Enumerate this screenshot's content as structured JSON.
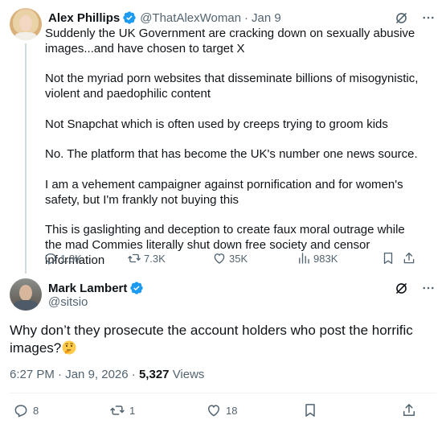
{
  "colors": {
    "text": "#0f1419",
    "muted": "#536471",
    "verified": "#1d9bf0",
    "thread_line": "#cfd9de"
  },
  "tweet1": {
    "author": {
      "name": "Alex Phillips",
      "handle": "@ThatAlexWoman",
      "separator": "·",
      "date": "Jan 9",
      "verified": true
    },
    "paragraphs": [
      "Suddenly the UK Government are cracking down on sexually abusive images...and have chosen to target X",
      "Not the myriad porn websites that disseminate billions of misogynistic, violent and paedophilic content",
      "Not Snapchat which is often used by creeps trying to groom kids",
      "No. The platform that has become the UK's number one news source.",
      "I am a vehement campaigner against pornification and for women's safety, but I'm frankly not buying this",
      "This is gaslighting and deception to create faux moral outrage while the mad Commies literally shut down free society and censor information"
    ],
    "stats": {
      "replies": "1.8K",
      "reposts": "7.3K",
      "likes": "35K",
      "views": "983K"
    }
  },
  "tweet2": {
    "author": {
      "name": "Mark Lambert",
      "handle": "@sitsio",
      "verified": true
    },
    "text": "Why don’t they prosecute the account holders who post the horrific images?",
    "emoji": "thinking-face",
    "meta": {
      "time": "6:27 PM",
      "separator1": "·",
      "date": "Jan 9, 2026",
      "separator2": "·",
      "views_count": "5,327",
      "views_label": "Views"
    },
    "stats": {
      "replies": "8",
      "reposts": "1",
      "likes": "18"
    }
  }
}
